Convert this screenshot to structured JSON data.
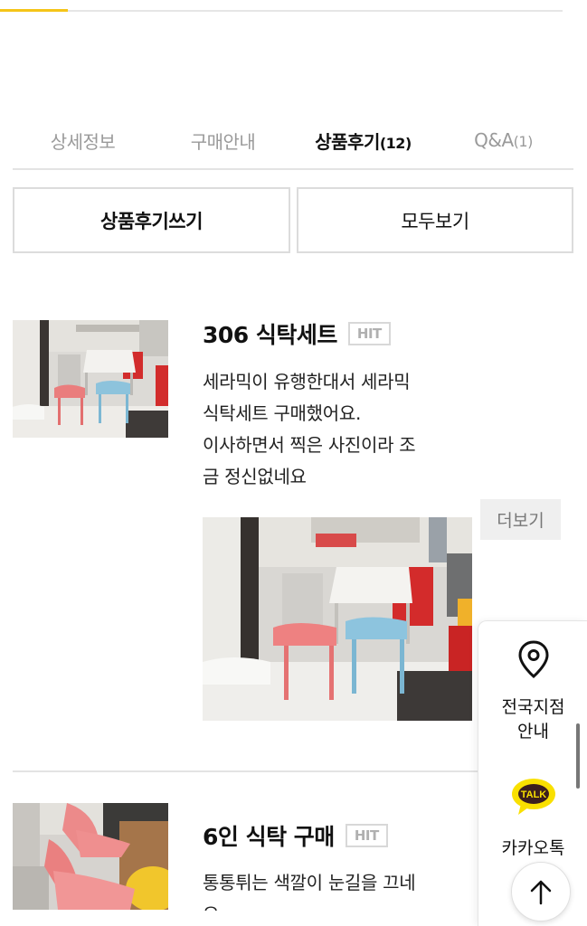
{
  "progress": {
    "fill_fraction": 0.12,
    "accent_color": "#f5c518"
  },
  "tabs": [
    {
      "label": "상세정보",
      "count": ""
    },
    {
      "label": "구매안내",
      "count": ""
    },
    {
      "label": "상품후기",
      "count": "(12)"
    },
    {
      "label": "Q&A",
      "count": "(1)"
    }
  ],
  "active_tab": 2,
  "actions": {
    "write_label": "상품후기쓰기",
    "view_all_label": "모두보기"
  },
  "reviews": [
    {
      "title": "306 식탁세트",
      "badge": "HIT",
      "lines": [
        "세라믹이 유행한대서 세라믹",
        "식탁세트 구매했어요.",
        "이사하면서 찍은 사진이라 조",
        "금 정신없네요"
      ],
      "more_label": "더보기"
    },
    {
      "title": "6인 식탁 구매",
      "badge": "HIT",
      "lines": [
        "통통튀는 색깔이 눈길을 끄네",
        "요"
      ]
    }
  ],
  "floating": {
    "store_label_line1": "전국지점",
    "store_label_line2": "안내",
    "kakao_badge": "TALK",
    "kakao_label": "카카오톡",
    "kakao_color": "#f9e000"
  },
  "icons": {
    "store": "location-pin-icon",
    "kakao": "kakao-talk-icon",
    "scroll_top": "arrow-up-icon"
  }
}
